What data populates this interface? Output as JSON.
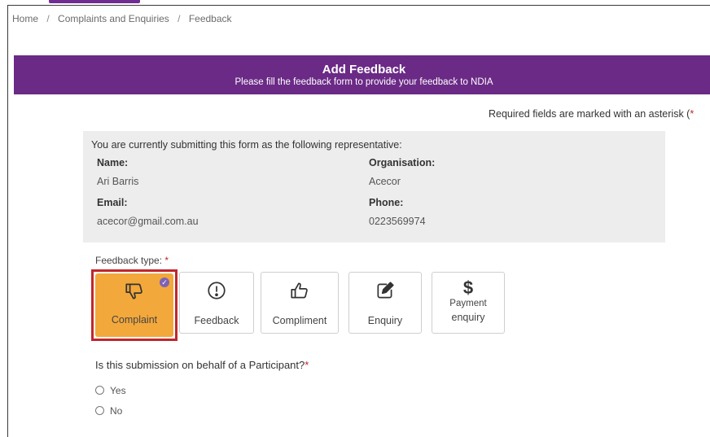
{
  "breadcrumb": {
    "items": [
      "Home",
      "Complaints and Enquiries",
      "Feedback"
    ],
    "separator": "/"
  },
  "banner": {
    "title": "Add Feedback",
    "subtitle": "Please fill the feedback form to provide your feedback to NDIA",
    "color": "#6b2a86"
  },
  "required_note": {
    "text": "Required fields are marked with an asterisk (",
    "star": "*"
  },
  "representative": {
    "intro": "You are currently submitting this form as the following representative:",
    "name_label": "Name:",
    "name_value": "Ari Barris",
    "org_label": "Organisation:",
    "org_value": "Acecor",
    "email_label": "Email:",
    "email_value": "acecor@gmail.com.au",
    "phone_label": "Phone:",
    "phone_value": "0223569974"
  },
  "feedback_type": {
    "label": "Feedback type:",
    "star": "*",
    "selected": "complaint",
    "selected_color": "#f3a83b",
    "options": [
      {
        "id": "complaint",
        "label": "Complaint",
        "icon": "thumbs-down-icon"
      },
      {
        "id": "feedback",
        "label": "Feedback",
        "icon": "exclamation-circle-icon"
      },
      {
        "id": "compliment",
        "label": "Compliment",
        "icon": "thumbs-up-icon"
      },
      {
        "id": "enquiry",
        "label": "Enquiry",
        "icon": "edit-icon"
      },
      {
        "id": "payment-enquiry",
        "label_line1": "Payment",
        "label_line2": "enquiry",
        "glyph": "$",
        "icon": "dollar-icon"
      }
    ]
  },
  "participant_question": {
    "text": "Is this submission on behalf of a Participant?",
    "star": "*",
    "options": [
      "Yes",
      "No"
    ]
  }
}
